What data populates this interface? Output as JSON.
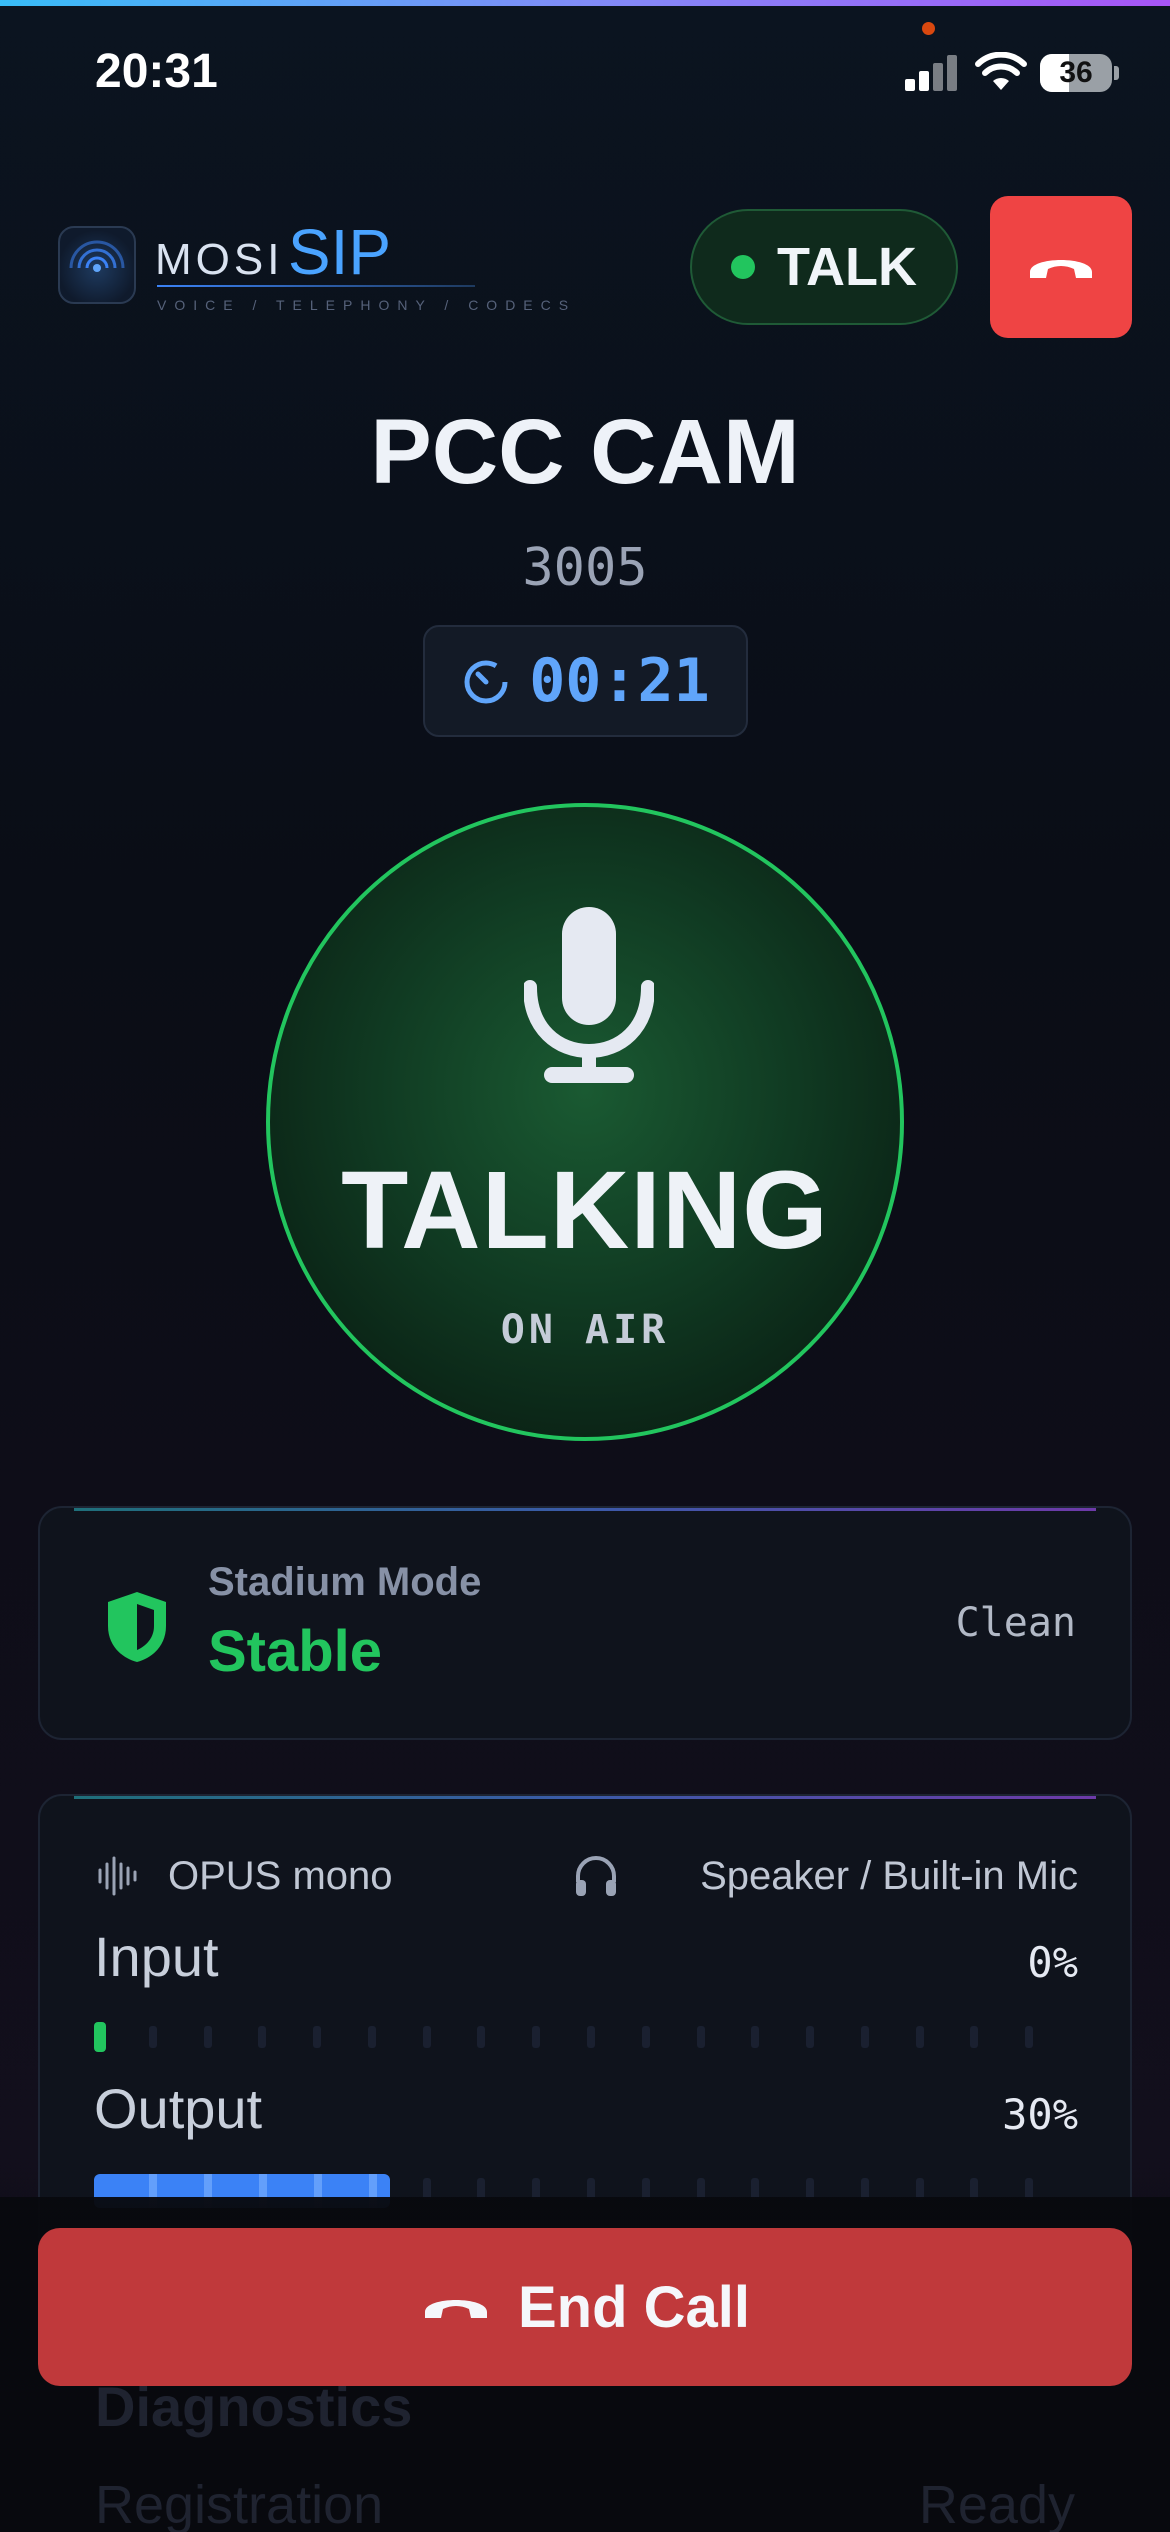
{
  "status_bar": {
    "time": "20:31",
    "battery": "36"
  },
  "header": {
    "brand_mosi": "MOSI",
    "brand_sip": "SIP",
    "tagline": "VOICE / TELEPHONY / CODECS",
    "talk_status": "TALK",
    "talk_status_color": "#22c55e",
    "hangup_color": "#ef4444"
  },
  "call": {
    "name": "PCC CAM",
    "extension": "3005",
    "timer": "00:21",
    "state": "TALKING",
    "state_sub": "ON AIR"
  },
  "stadium": {
    "title": "Stadium Mode",
    "value": "Stable",
    "quality": "Clean"
  },
  "audio": {
    "codec": "OPUS mono",
    "device": "Speaker / Built-in Mic",
    "input_label": "Input",
    "input_value": "0%",
    "input_level": 0.0,
    "output_label": "Output",
    "output_value": "30%",
    "output_level": 0.3
  },
  "diagnostics": {
    "title": "Diagnostics",
    "row_label": "Registration",
    "row_value": "Ready"
  },
  "footer": {
    "end_call": "End Call",
    "end_call_color": "#c0393b"
  },
  "icons": [
    "signal-icon",
    "wifi-icon",
    "battery-icon",
    "radar-logo-icon",
    "phone-hangup-icon",
    "timer-icon",
    "microphone-icon",
    "shield-icon",
    "waveform-icon",
    "headphones-icon"
  ]
}
